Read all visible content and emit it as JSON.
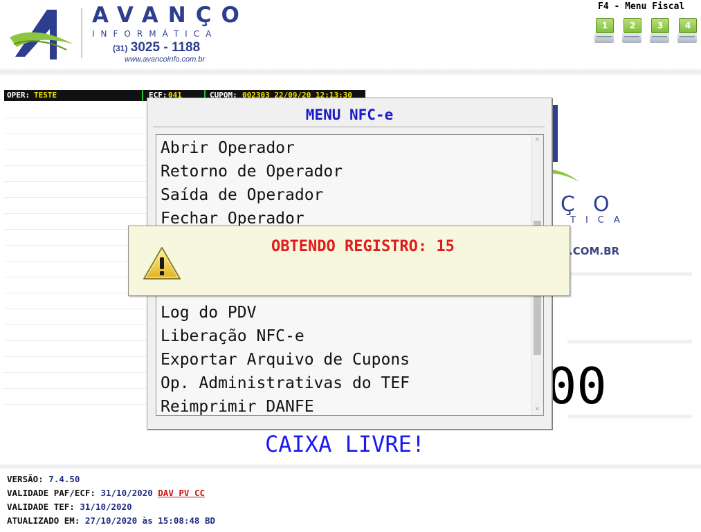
{
  "header": {
    "brand_name": "AVANÇO",
    "brand_sub": "INFORMÁTICA",
    "phone_prefix": "(31)",
    "phone": "3025 - 1188",
    "website": "www.avancoinfo.com.br",
    "menu_fiscal_title": "F4 - Menu Fiscal",
    "fiscal_keys": [
      "1",
      "2",
      "3",
      "4"
    ]
  },
  "status": {
    "oper_label": "OPER:",
    "oper_value": "TESTE",
    "ecf_label": "ECF:",
    "ecf_value": "041",
    "cupom_label": "CUPOM:",
    "cupom_value": "002303 22/09/20 12:13:30"
  },
  "background": {
    "brand_chars": "ÇO",
    "brand_sub": "TICA",
    "website": ".COM.BR",
    "total": "00"
  },
  "menu": {
    "title": "MENU NFC-e",
    "items": [
      "Abrir Operador",
      "Retorno de Operador",
      "Saída de Operador",
      "Fechar Operador",
      "Log do PDV",
      "Liberação NFC-e",
      "Exportar Arquivo de Cupons",
      "Op. Administrativas do TEF",
      "Reimprimir DANFE"
    ],
    "scroll_up": "˄",
    "scroll_down": "˅"
  },
  "alert": {
    "message": "OBTENDO REGISTRO: 15",
    "icon": "warning-icon"
  },
  "main": {
    "caixa_status": "CAIXA LIVRE!"
  },
  "footer": {
    "versao_label": "VERSÃO:",
    "versao_value": "7.4.50",
    "validade_paf_label": "VALIDADE PAF/ECF:",
    "validade_paf_value": "31/10/2020",
    "validade_paf_link": "DAV PV CC",
    "validade_tef_label": "VALIDADE TEF:",
    "validade_tef_value": "31/10/2020",
    "atualizado_label": "ATUALIZADO EM:",
    "atualizado_value": "27/10/2020 às 15:08:48 BD"
  },
  "colors": {
    "brand_blue": "#2d3e8f",
    "menu_title": "#1a1acc",
    "alert_text": "#e01b1b",
    "status_value": "#f4e200",
    "caixa_livre": "#1a1aee",
    "footer_link": "#cc1111"
  }
}
